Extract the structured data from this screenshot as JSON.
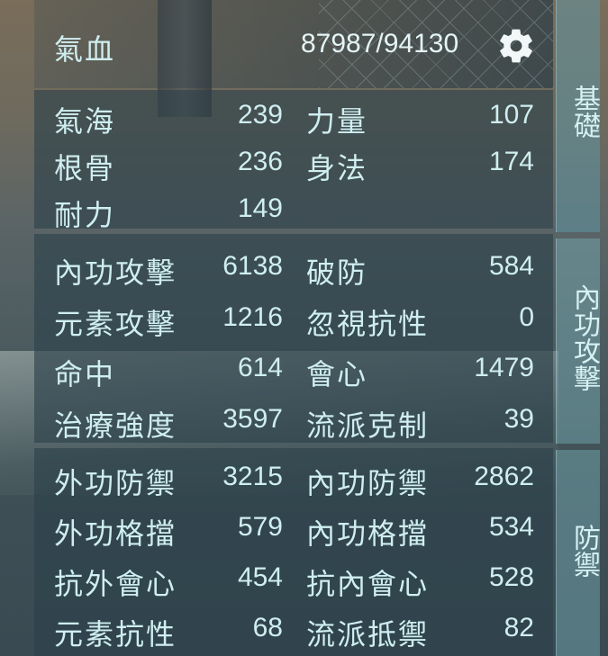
{
  "hp": {
    "label": "氣血",
    "value": "87987/94130"
  },
  "tabs": [
    {
      "label": "基礎"
    },
    {
      "label": "內功攻擊"
    },
    {
      "label": "防禦"
    }
  ],
  "basic": [
    {
      "label": "氣海",
      "value": "239"
    },
    {
      "label": "力量",
      "value": "107"
    },
    {
      "label": "根骨",
      "value": "236"
    },
    {
      "label": "身法",
      "value": "174"
    },
    {
      "label": "耐力",
      "value": "149"
    }
  ],
  "attack": [
    {
      "label": "內功攻擊",
      "value": "6138"
    },
    {
      "label": "破防",
      "value": "584"
    },
    {
      "label": "元素攻擊",
      "value": "1216"
    },
    {
      "label": "忽視抗性",
      "value": "0"
    },
    {
      "label": "命中",
      "value": "614"
    },
    {
      "label": "會心",
      "value": "1479"
    },
    {
      "label": "治療強度",
      "value": "3597"
    },
    {
      "label": "流派克制",
      "value": "39"
    }
  ],
  "defense": [
    {
      "label": "外功防禦",
      "value": "3215"
    },
    {
      "label": "內功防禦",
      "value": "2862"
    },
    {
      "label": "外功格擋",
      "value": "579"
    },
    {
      "label": "內功格擋",
      "value": "534"
    },
    {
      "label": "抗外會心",
      "value": "454"
    },
    {
      "label": "抗內會心",
      "value": "528"
    },
    {
      "label": "元素抗性",
      "value": "68"
    },
    {
      "label": "流派抵禦",
      "value": "82"
    }
  ]
}
